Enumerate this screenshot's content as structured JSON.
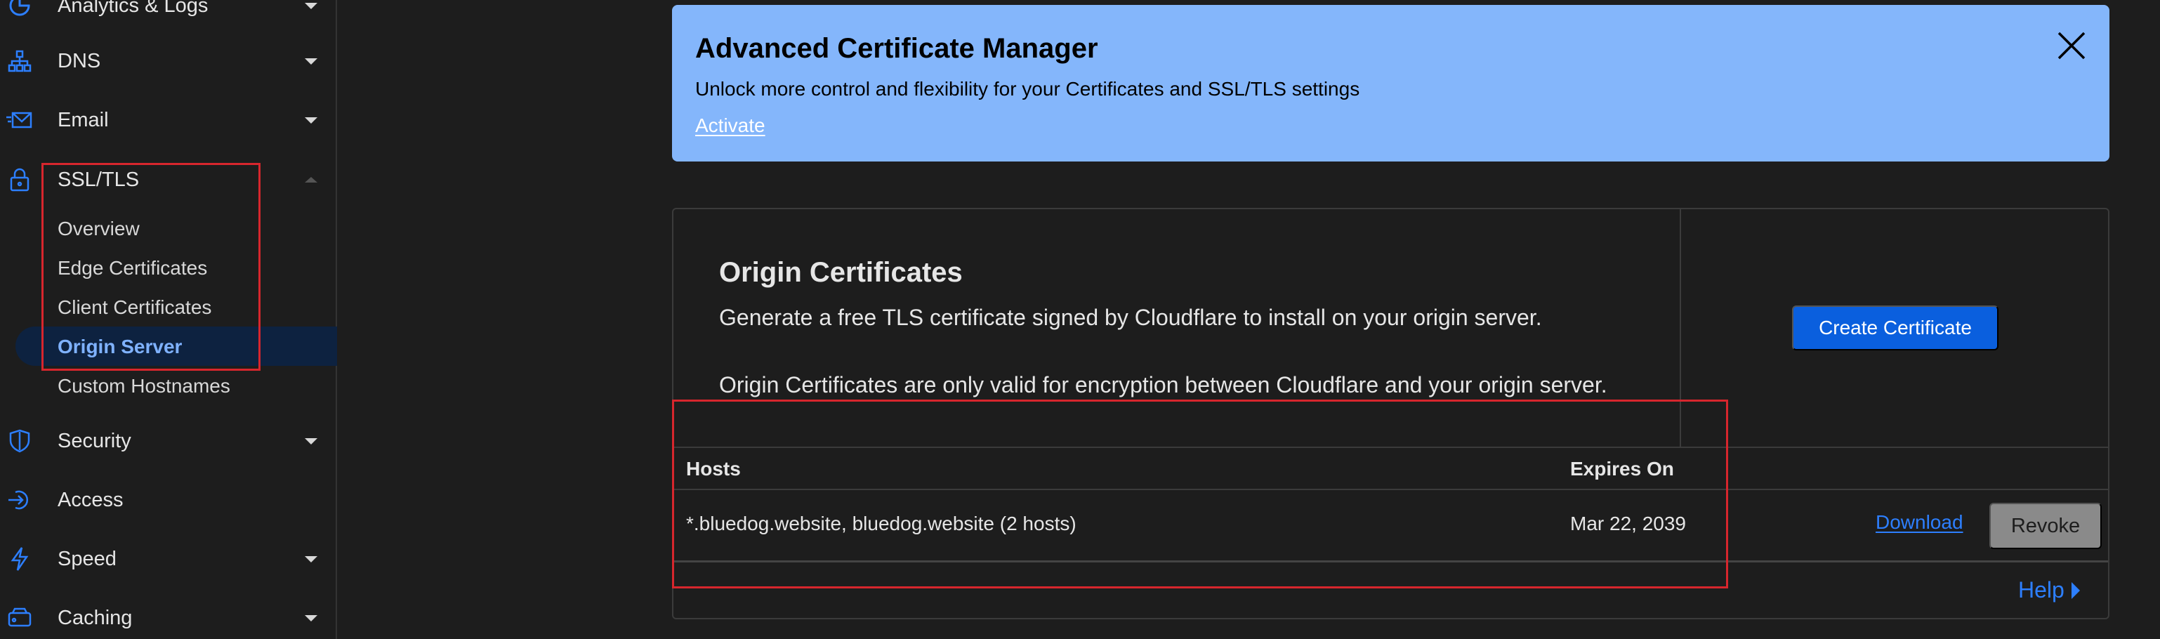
{
  "sidebar": {
    "items": [
      {
        "label": "Analytics & Logs",
        "icon": "analytics-icon"
      },
      {
        "label": "DNS",
        "icon": "dns-network-icon"
      },
      {
        "label": "Email",
        "icon": "email-icon"
      },
      {
        "label": "SSL/TLS",
        "icon": "lock-icon"
      },
      {
        "label": "Security",
        "icon": "shield-icon"
      },
      {
        "label": "Access",
        "icon": "access-icon"
      },
      {
        "label": "Speed",
        "icon": "lightning-icon"
      },
      {
        "label": "Caching",
        "icon": "caching-icon"
      }
    ],
    "ssl_sub_items": [
      "Overview",
      "Edge Certificates",
      "Client Certificates",
      "Origin Server",
      "Custom Hostnames"
    ],
    "active_sub_item": "Origin Server"
  },
  "banner": {
    "title": "Advanced Certificate Manager",
    "text": "Unlock more control and flexibility for your Certificates and SSL/TLS settings",
    "link": "Activate",
    "close_icon": "close-icon"
  },
  "origin_certificates": {
    "title": "Origin Certificates",
    "desc1": "Generate a free TLS certificate signed by Cloudflare to install on your origin server.",
    "desc2": "Origin Certificates are only valid for encryption between Cloudflare and your origin server.",
    "create_button": "Create Certificate",
    "columns": [
      "Hosts",
      "Expires On"
    ],
    "rows": [
      {
        "hosts": "*.bluedog.website, bluedog.website (2 hosts)",
        "expires": "Mar 22, 2039"
      }
    ],
    "download_label": "Download",
    "revoke_label": "Revoke",
    "help_label": "Help"
  },
  "colors": {
    "accent": "#0a5fde",
    "link": "#2d7fff",
    "banner_bg": "#84b6fb",
    "highlight_box": "#d7262d",
    "background": "#1d1d1d"
  }
}
